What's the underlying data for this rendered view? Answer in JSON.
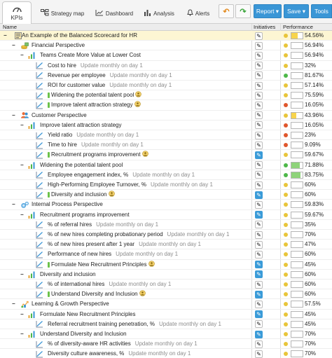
{
  "colors": {
    "accent": "#3a96d6",
    "good": "#4db848",
    "warn": "#e8c53a",
    "bad": "#e0562c",
    "fill_green": "#8ed37a",
    "fill_yellow": "#f7d44c"
  },
  "toolbar": {
    "tabs": [
      {
        "label": "KPIs",
        "icon": "dashboard-icon"
      },
      {
        "label": "Strategy map",
        "icon": "sitemap-icon"
      },
      {
        "label": "Dashboard",
        "icon": "chart-icon"
      },
      {
        "label": "Analysis",
        "icon": "analysis-icon"
      },
      {
        "label": "Alerts",
        "icon": "bell-icon"
      }
    ],
    "report_label": "Report ▾",
    "save_label": "Save ▾",
    "tools_label": "Tools"
  },
  "columns": {
    "name": "Name",
    "initiatives": "Initiatives",
    "performance": "Performance"
  },
  "rows": [
    {
      "level": 0,
      "type": "scorecard",
      "toggle": "−",
      "name": "An Example of the Balanced Scorecard for HR",
      "update": "",
      "init": "edit",
      "status": "yellow",
      "pct": "54.56%",
      "perf": 54.56,
      "fill": "yellow",
      "hl": true
    },
    {
      "level": 1,
      "type": "perspective",
      "pico": "money",
      "toggle": "−",
      "name": "Financial Perspective",
      "update": "",
      "init": "edit",
      "status": "yellow",
      "pct": "56.94%",
      "perf": 0,
      "fill": ""
    },
    {
      "level": 2,
      "type": "objective",
      "toggle": "−",
      "name": "Teams Create More Value at Lower Cost",
      "update": "",
      "init": "edit",
      "status": "yellow",
      "pct": "56.94%",
      "perf": 0,
      "fill": ""
    },
    {
      "level": 3,
      "type": "kpi",
      "name": "Cost to hire",
      "update": "Update monthly on day 1",
      "init": "edit",
      "status": "yellow",
      "pct": "32%",
      "perf": 0,
      "fill": ""
    },
    {
      "level": 3,
      "type": "kpi",
      "name": "Revenue per employee",
      "update": "Update monthly on day 1",
      "init": "edit",
      "status": "green",
      "pct": "81.67%",
      "perf": 0,
      "fill": ""
    },
    {
      "level": 3,
      "type": "kpi",
      "name": "ROI for customer value",
      "update": "Update monthly on day 1",
      "init": "edit",
      "status": "yellow",
      "pct": "57.14%",
      "perf": 0,
      "fill": ""
    },
    {
      "level": 3,
      "type": "initiative",
      "name": "Widening the potential talent pool",
      "update": "",
      "init": "edit",
      "status": "yellow",
      "pct": "75.59%",
      "perf": 0,
      "fill": ""
    },
    {
      "level": 3,
      "type": "initiative",
      "name": "Improve talent attraction strategy",
      "update": "",
      "init": "edit",
      "status": "red",
      "pct": "16.05%",
      "perf": 0,
      "fill": ""
    },
    {
      "level": 1,
      "type": "perspective",
      "pico": "people",
      "toggle": "−",
      "name": "Customer Perspective",
      "update": "",
      "init": "edit",
      "status": "yellow",
      "pct": "43.96%",
      "perf": 43.96,
      "fill": "yellow"
    },
    {
      "level": 2,
      "type": "objective",
      "toggle": "−",
      "name": "Improve talent attraction strategy",
      "update": "",
      "init": "edit",
      "status": "red",
      "pct": "16.05%",
      "perf": 0,
      "fill": ""
    },
    {
      "level": 3,
      "type": "kpi",
      "name": "Yield ratio",
      "update": "Update monthly on day 1",
      "init": "edit",
      "status": "red",
      "pct": "23%",
      "perf": 0,
      "fill": ""
    },
    {
      "level": 3,
      "type": "kpi",
      "name": "Time to hire",
      "update": "Update monthly on day 1",
      "init": "edit",
      "status": "red",
      "pct": "9.09%",
      "perf": 0,
      "fill": ""
    },
    {
      "level": 3,
      "type": "initiative",
      "name": "Recruitment programs improvement",
      "update": "",
      "init": "blue",
      "status": "yellow",
      "pct": "59.67%",
      "perf": 0,
      "fill": ""
    },
    {
      "level": 2,
      "type": "objective",
      "toggle": "−",
      "name": "Widening the potential talent pool",
      "update": "",
      "init": "edit",
      "status": "green",
      "pct": "71.88%",
      "perf": 71.88,
      "fill": "green"
    },
    {
      "level": 3,
      "type": "kpi",
      "name": "Employee engagement index, %",
      "update": "Update monthly on day 1",
      "init": "edit",
      "status": "green",
      "pct": "83.75%",
      "perf": 83.75,
      "fill": "green"
    },
    {
      "level": 3,
      "type": "kpi",
      "name": "High-Performing Employee Turnover, %",
      "update": "Update monthly on day 1",
      "init": "edit",
      "status": "yellow",
      "pct": "60%",
      "perf": 0,
      "fill": ""
    },
    {
      "level": 3,
      "type": "initiative",
      "name": "Diversity and inclusion",
      "update": "",
      "init": "blue",
      "status": "yellow",
      "pct": "60%",
      "perf": 0,
      "fill": ""
    },
    {
      "level": 1,
      "type": "perspective",
      "pico": "gears",
      "toggle": "−",
      "name": "Internal Process Perspective",
      "update": "",
      "init": "edit",
      "status": "yellow",
      "pct": "59.83%",
      "perf": 0,
      "fill": ""
    },
    {
      "level": 2,
      "type": "objective",
      "toggle": "−",
      "name": "Recruitment programs improvement",
      "update": "",
      "init": "blue",
      "status": "yellow",
      "pct": "59.67%",
      "perf": 0,
      "fill": ""
    },
    {
      "level": 3,
      "type": "kpi",
      "name": "% of referral hires",
      "update": "Update monthly on day 1",
      "init": "edit",
      "status": "yellow",
      "pct": "35%",
      "perf": 0,
      "fill": ""
    },
    {
      "level": 3,
      "type": "kpi",
      "name": "% of new hires completing probationary period",
      "update": "Update monthly on day 1",
      "init": "edit",
      "status": "yellow",
      "pct": "70%",
      "perf": 0,
      "fill": ""
    },
    {
      "level": 3,
      "type": "kpi",
      "name": "% of new hires present after 1 year",
      "update": "Update monthly on day 1",
      "init": "edit",
      "status": "yellow",
      "pct": "47%",
      "perf": 0,
      "fill": ""
    },
    {
      "level": 3,
      "type": "kpi",
      "name": "Performance of new hires",
      "update": "Update monthly on day 1",
      "init": "edit",
      "status": "yellow",
      "pct": "60%",
      "perf": 0,
      "fill": ""
    },
    {
      "level": 3,
      "type": "initiative",
      "name": "Formulate New Recruitment Principles",
      "update": "",
      "init": "blue",
      "status": "yellow",
      "pct": "45%",
      "perf": 0,
      "fill": ""
    },
    {
      "level": 2,
      "type": "objective",
      "toggle": "−",
      "name": "Diversity and inclusion",
      "update": "",
      "init": "blue",
      "status": "yellow",
      "pct": "60%",
      "perf": 0,
      "fill": ""
    },
    {
      "level": 3,
      "type": "kpi",
      "name": "% of international hires",
      "update": "Update monthly on day 1",
      "init": "edit",
      "status": "yellow",
      "pct": "60%",
      "perf": 0,
      "fill": ""
    },
    {
      "level": 3,
      "type": "initiative",
      "name": "Understand Diversity and Inclusion",
      "update": "",
      "init": "blue",
      "status": "yellow",
      "pct": "60%",
      "perf": 0,
      "fill": ""
    },
    {
      "level": 1,
      "type": "perspective",
      "pico": "growth",
      "toggle": "−",
      "name": "Learning & Growth Perspective",
      "update": "",
      "init": "edit",
      "status": "yellow",
      "pct": "57.5%",
      "perf": 0,
      "fill": ""
    },
    {
      "level": 2,
      "type": "objective",
      "toggle": "−",
      "name": "Formulate New Recruitment Principles",
      "update": "",
      "init": "blue",
      "status": "yellow",
      "pct": "45%",
      "perf": 0,
      "fill": ""
    },
    {
      "level": 3,
      "type": "kpi",
      "name": "Referral recruitment training penetration, %",
      "update": "Update monthly on day 1",
      "init": "edit",
      "status": "yellow",
      "pct": "45%",
      "perf": 0,
      "fill": ""
    },
    {
      "level": 2,
      "type": "objective",
      "toggle": "−",
      "name": "Understand Diversity and Inclusion",
      "update": "",
      "init": "blue",
      "status": "yellow",
      "pct": "70%",
      "perf": 0,
      "fill": ""
    },
    {
      "level": 3,
      "type": "kpi",
      "name": "% of diversity-aware HR activities",
      "update": "Update monthly on day 1",
      "init": "edit",
      "status": "yellow",
      "pct": "70%",
      "perf": 0,
      "fill": ""
    },
    {
      "level": 3,
      "type": "kpi",
      "name": "Diversity culture awareness, %",
      "update": "Update monthly on day 1",
      "init": "edit",
      "status": "yellow",
      "pct": "70%",
      "perf": 0,
      "fill": ""
    }
  ]
}
